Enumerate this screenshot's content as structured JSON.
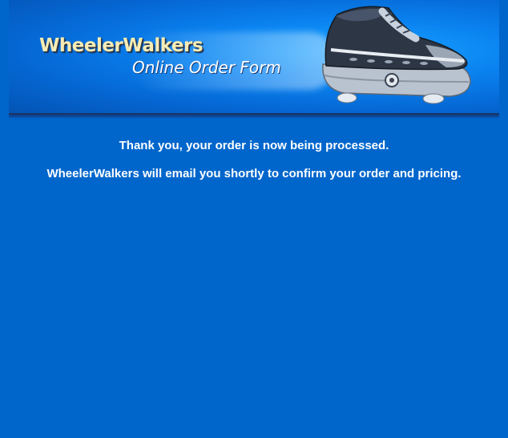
{
  "header": {
    "logo_title": "WheelerWalkers",
    "logo_subtitle": "Online Order Form",
    "shoe_image": "wheeled-sneaker-icon"
  },
  "main": {
    "confirmation_line": "Thank you, your order is now being processed.",
    "email_notice": "WheelerWalkers will email you shortly to confirm your order and pricing."
  },
  "colors": {
    "page_background": "#0066cc",
    "banner_blue": "#0a82f0",
    "logo_title": "#f6ecb6",
    "text": "#ffffff"
  }
}
